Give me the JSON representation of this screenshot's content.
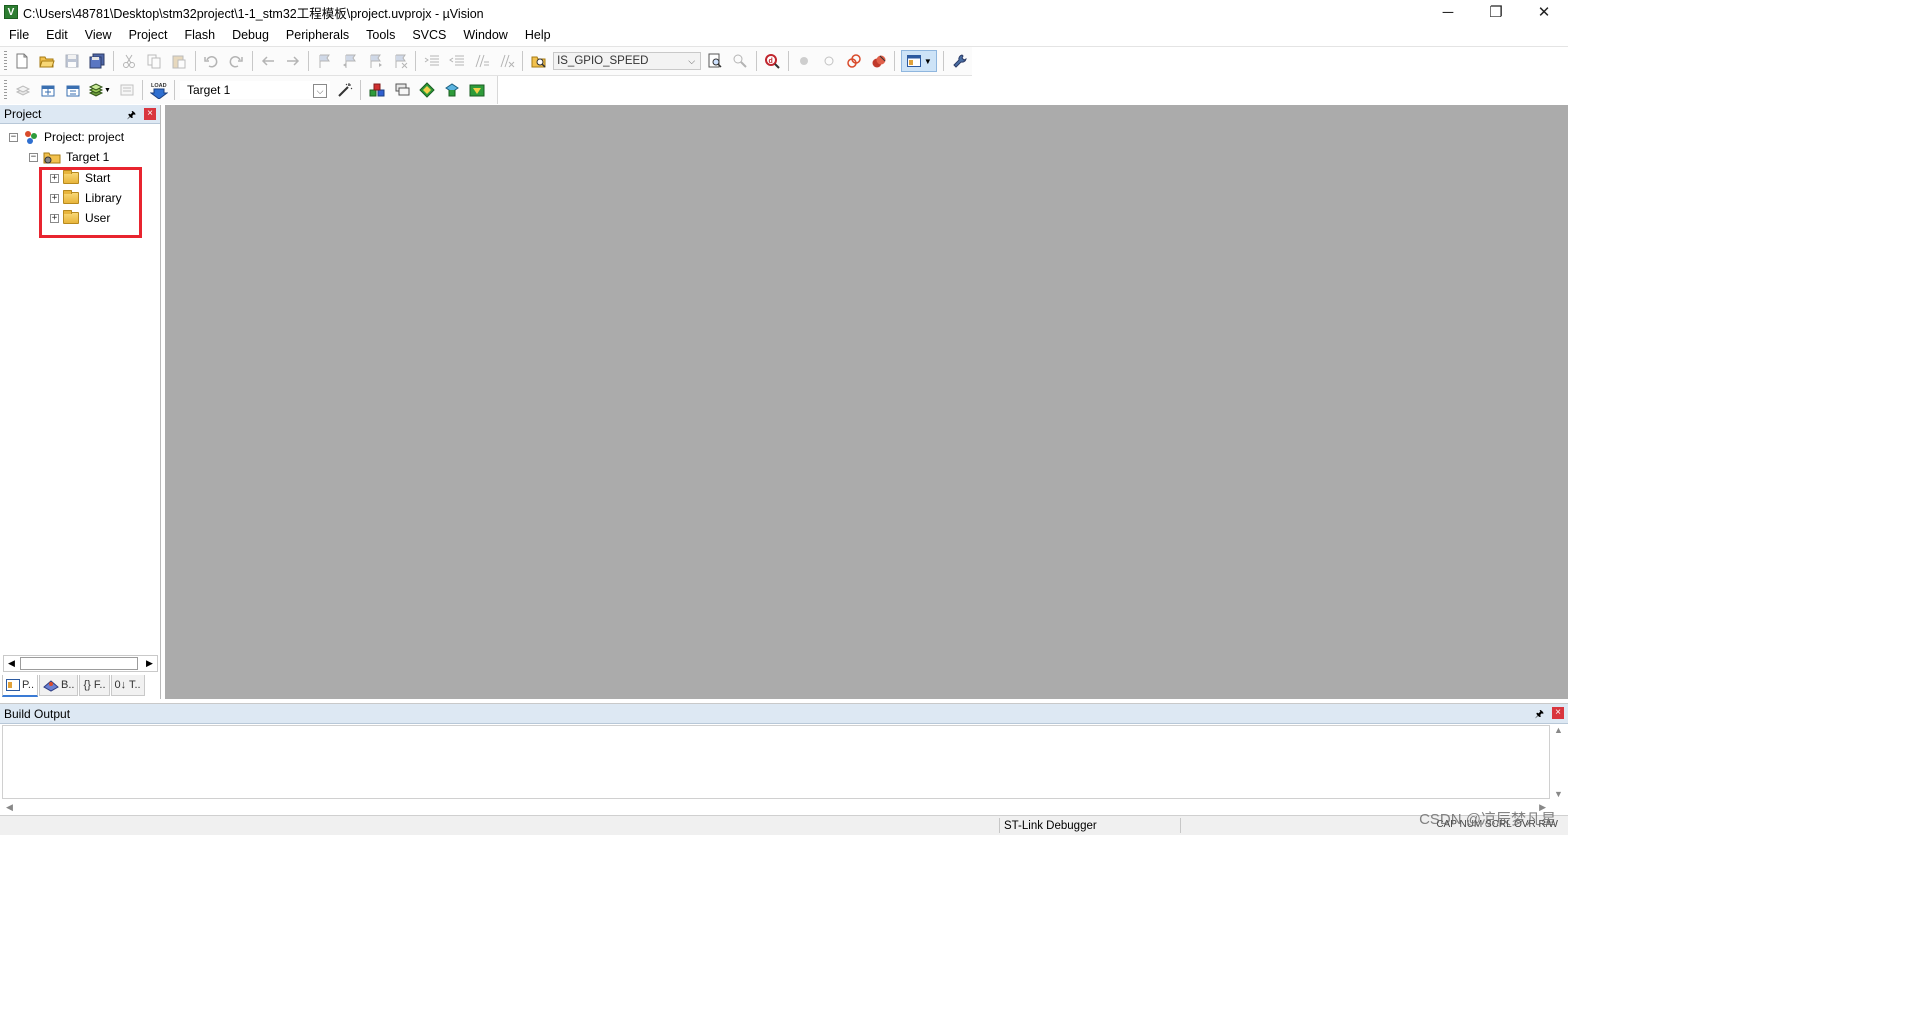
{
  "window": {
    "title": "C:\\Users\\48781\\Desktop\\stm32project\\1-1_stm32工程模板\\project.uvprojx - µVision",
    "app_icon_letter": "V",
    "minimize": "─",
    "restore": "❐",
    "close": "✕"
  },
  "menu": {
    "items": [
      {
        "label": "File"
      },
      {
        "label": "Edit"
      },
      {
        "label": "View"
      },
      {
        "label": "Project"
      },
      {
        "label": "Flash"
      },
      {
        "label": "Debug"
      },
      {
        "label": "Peripherals"
      },
      {
        "label": "Tools"
      },
      {
        "label": "SVCS"
      },
      {
        "label": "Window"
      },
      {
        "label": "Help"
      }
    ]
  },
  "toolbar1": {
    "find_combo_value": "IS_GPIO_SPEED"
  },
  "toolbar2": {
    "load_label": "LOAD",
    "target_combo_value": "Target 1"
  },
  "project_panel": {
    "title": "Project",
    "pin": "🖈",
    "close": "×",
    "root": {
      "label": "Project: project",
      "expander": "−"
    },
    "target": {
      "label": "Target 1",
      "expander": "−"
    },
    "groups": [
      {
        "label": "Start",
        "expander": "+"
      },
      {
        "label": "Library",
        "expander": "+"
      },
      {
        "label": "User",
        "expander": "+"
      }
    ],
    "tabs": [
      {
        "label": "P..",
        "icon": "project-tab-icon"
      },
      {
        "label": "B..",
        "icon": "books-tab-icon"
      },
      {
        "label": "{} F..",
        "icon": "functions-tab-icon"
      },
      {
        "label": "0↓ T..",
        "icon": "templates-tab-icon"
      }
    ],
    "scroll_left": "◀",
    "scroll_right": "▶"
  },
  "build_output": {
    "title": "Build Output",
    "pin": "🖈",
    "close": "×",
    "scroll_up": "▲",
    "scroll_down": "▼",
    "scroll_left": "◀",
    "scroll_right": "▶"
  },
  "statusbar": {
    "debugger": "ST-Link Debugger",
    "keys": "CAP  NUM  SCRL  OVR  R/W"
  },
  "watermark": "CSDN @凉辰梦凡星",
  "colors": {
    "highlight_box": "#e8242f",
    "editor_background": "#ababab",
    "panel_header": "#dde8f3"
  }
}
